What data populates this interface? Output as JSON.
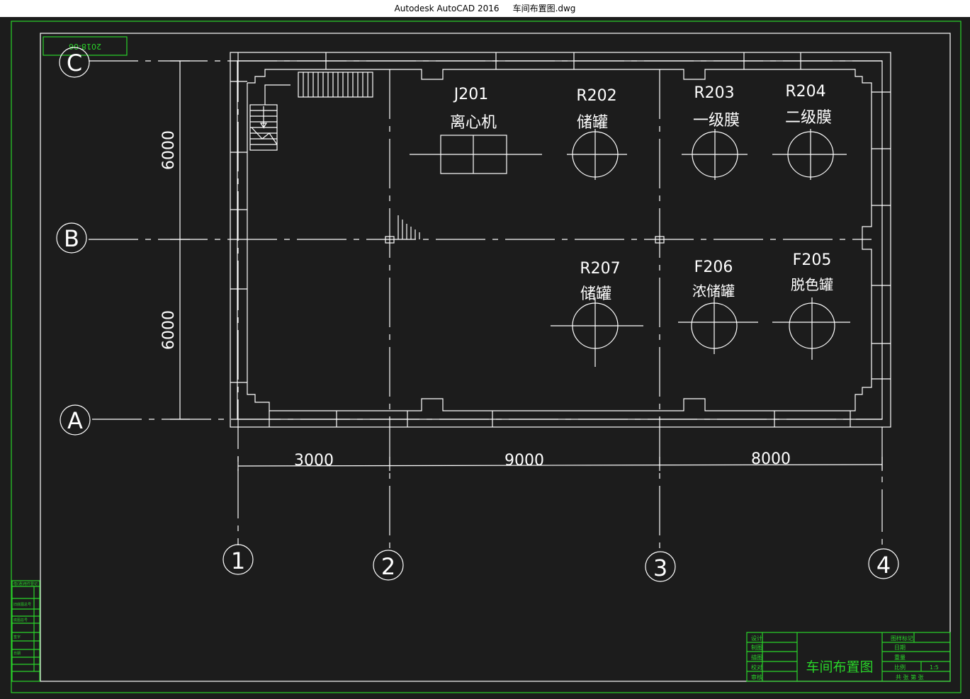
{
  "window": {
    "app_title": "Autodesk AutoCAD 2016",
    "file_name": "车间布置图.dwg"
  },
  "stamp": {
    "text": "2018-06"
  },
  "grid_axes": {
    "rows": [
      "C",
      "B",
      "A"
    ],
    "cols": [
      "1",
      "2",
      "3",
      "4"
    ]
  },
  "dimensions": {
    "row_spacing_top": "6000",
    "row_spacing_bottom": "6000",
    "col_1_2": "3000",
    "col_2_3": "9000",
    "col_3_4": "8000"
  },
  "equipment": [
    {
      "tag": "J201",
      "name": "离心机"
    },
    {
      "tag": "R202",
      "name": "储罐"
    },
    {
      "tag": "R203",
      "name": "一级膜"
    },
    {
      "tag": "R204",
      "name": "二级膜"
    },
    {
      "tag": "R207",
      "name": "储罐"
    },
    {
      "tag": "F206",
      "name": "浓储罐"
    },
    {
      "tag": "F205",
      "name": "脱色罐"
    }
  ],
  "title_block": {
    "drawing_title": "车间布置图",
    "left_labels": [
      "设计",
      "制图",
      "描图",
      "校对",
      "审核"
    ],
    "right_labels": [
      "图样标记",
      "日期",
      "重量",
      "比例"
    ],
    "scale": "1:5",
    "sheet_text": "共 张 第 张"
  },
  "side_strip": {
    "labels": [
      "借(通)用件登记",
      "旧底图总号",
      "底图总号",
      "签字",
      "日期"
    ]
  },
  "colors": {
    "lines": "#ffffff",
    "frame": "#29d429",
    "background": "#1c1c1c"
  }
}
